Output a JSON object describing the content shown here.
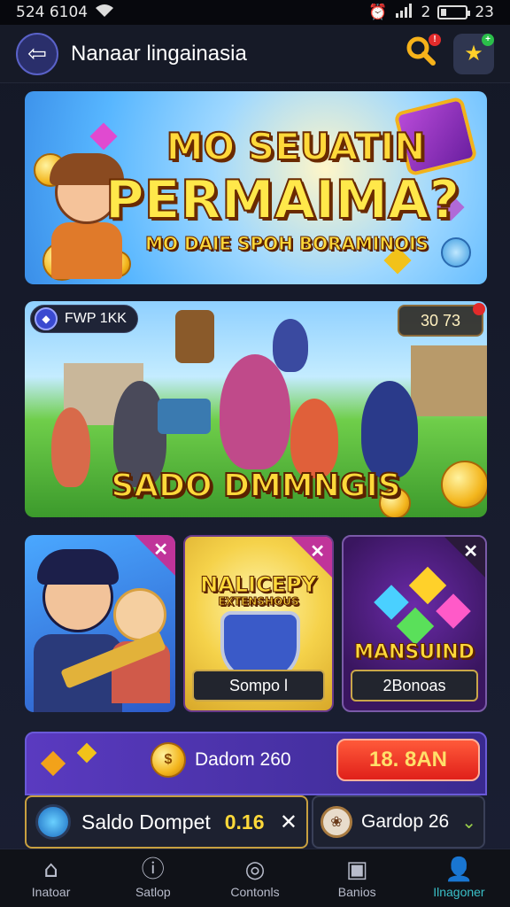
{
  "status_bar": {
    "time": "524 6104",
    "right_text": "2",
    "clock_right": "23"
  },
  "header": {
    "title": "Nanaar lingainasia"
  },
  "banner1": {
    "line1": "MO SEUATIN",
    "line2": "PERMAIMA?",
    "line3": "MO DAIE SPOH BORAMINOIS"
  },
  "banner2": {
    "tag": "FWP 1KK",
    "score": "30 73",
    "title": "SADO DMMNGIS"
  },
  "cards": [
    {
      "label": ""
    },
    {
      "title": "NALICEPY",
      "subtitle": "EXTENSHOUS",
      "label": "Sompo l"
    },
    {
      "title": "MANSUIND",
      "label": "2Bonoas"
    }
  ],
  "promo": {
    "text": "Dadom 260",
    "button": "18. 8AN"
  },
  "wallet": {
    "label": "Saldo Dompet",
    "value": "0.16"
  },
  "garden": {
    "label": "Gardop 26"
  },
  "nav": [
    {
      "label": "Inatoar",
      "icon": "home-icon"
    },
    {
      "label": "Satlop",
      "icon": "info-icon"
    },
    {
      "label": "Contonls",
      "icon": "controls-icon"
    },
    {
      "label": "Banios",
      "icon": "box-icon"
    },
    {
      "label": "Ilnagoner",
      "icon": "profile-icon"
    }
  ],
  "colors": {
    "accent": "#3ac0c8",
    "gold": "#ffd93a",
    "promo_button": "#e0201a"
  }
}
